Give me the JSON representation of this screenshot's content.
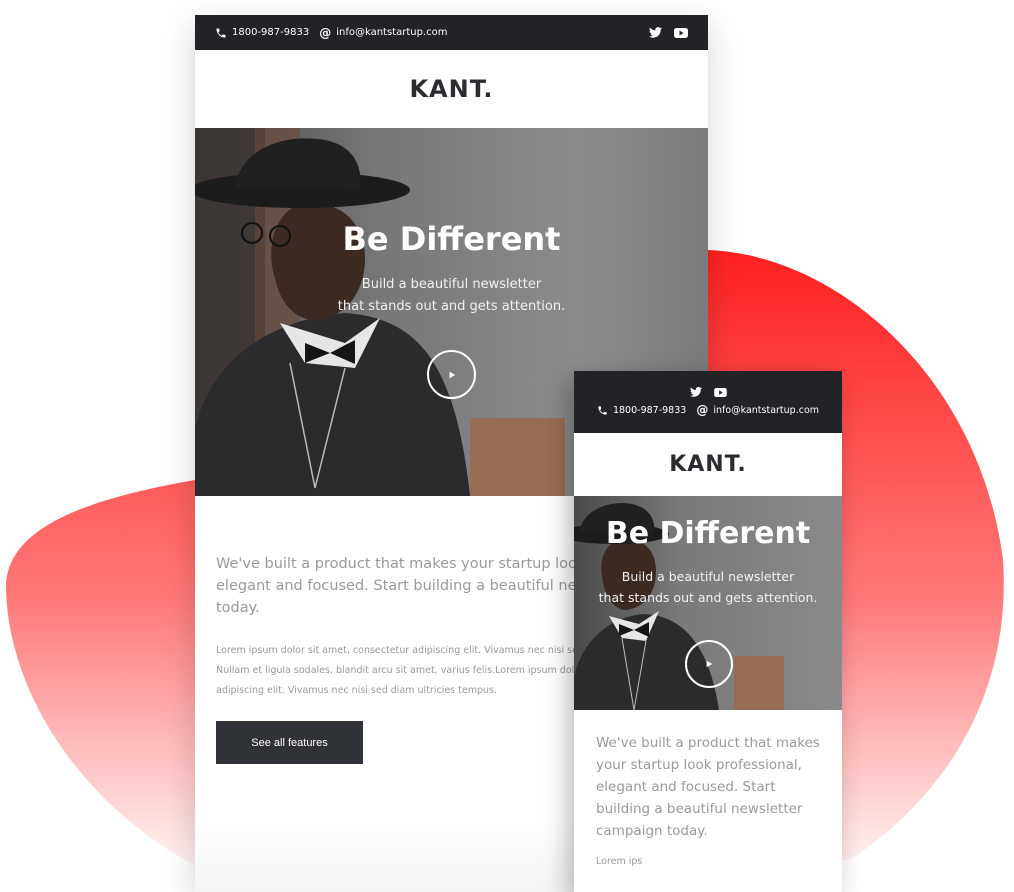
{
  "colors": {
    "accent_red": "#ff2a2a",
    "dark_bar": "#222326",
    "button_dark": "#2f3236",
    "text_gray": "#9a9a9a"
  },
  "desktop": {
    "topbar": {
      "phone_icon": "phone-icon",
      "phone": "1800-987-9833",
      "email_icon": "at-icon",
      "email": "info@kantstartup.com",
      "socials": [
        "twitter-icon",
        "youtube-icon"
      ]
    },
    "logo": "KANT.",
    "hero": {
      "title": "Be Different",
      "subtitle_line1": "Build a beautiful newsletter",
      "subtitle_line2": "that stands out and gets attention."
    },
    "lead_line1": "We've built a product that makes your startup look p",
    "lead_line2": "elegant and focused. Start building a beautiful newsl",
    "lead_line3": "today.",
    "body_line1": "Lorem ipsum dolor sit amet, consectetur adipiscing elit. Vivamus nec nisi sed",
    "body_line2": "Nullam et ligula sodales, blandit arcu sit amet, varius felis.Lorem ipsum dolor sit",
    "body_line3": "adipiscing elit. Vivamus nec nisi sed diam ultricies tempus.",
    "cta_label": "See all features"
  },
  "mobile": {
    "topbar": {
      "phone": "1800-987-9833",
      "email": "info@kantstartup.com"
    },
    "logo": "KANT.",
    "hero": {
      "title": "Be Different",
      "subtitle_line1": "Build a beautiful newsletter",
      "subtitle_line2": "that stands out and gets attention."
    },
    "lead_line1": "We've built a product that makes",
    "lead_line2": "your startup look professional,",
    "lead_line3": "elegant and focused. Start",
    "lead_line4": "building a beautiful newsletter",
    "lead_line5": "campaign today.",
    "body_partial": "Lorem ips"
  }
}
